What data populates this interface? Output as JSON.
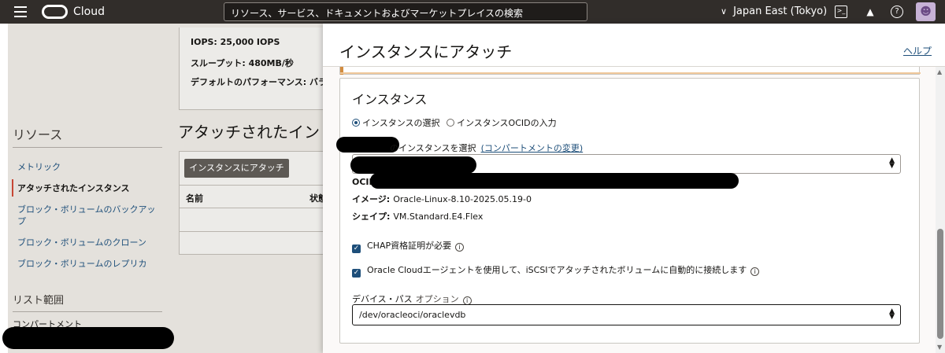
{
  "topbar": {
    "brand": "Cloud",
    "search_placeholder": "リソース、サービス、ドキュメントおよびマーケットプレイスの検索",
    "region": "Japan East (Tokyo)"
  },
  "background": {
    "info": {
      "iops": "IOPS: 25,000 IOPS",
      "throughput": "スループット: 480MB/秒",
      "default_perf": "デフォルトのパフォーマンス: バラ"
    },
    "resources": {
      "title": "リソース",
      "items": [
        "メトリック",
        "アタッチされたインスタンス",
        "ブロック・ボリュームのバックアップ",
        "ブロック・ボリュームのクローン",
        "ブロック・ボリュームのレプリカ"
      ]
    },
    "list_scope": "リスト範囲",
    "compartment_label": "コンパートメント",
    "attached_title": "アタッチされたイン",
    "attach_button": "インスタンスにアタッチ",
    "table_headers": [
      "名前",
      "状態"
    ]
  },
  "panel": {
    "title": "インスタンスにアタッチ",
    "help": "ヘルプ",
    "card_title": "インスタンス",
    "radio_select": "インスタンスの選択",
    "radio_ocid": "インスタンスOCIDの入力",
    "select_label": "のインスタンスを選択",
    "change_compartment": "(コンパートメントの変更)",
    "ocid_label": "OCID",
    "image_label": "イメージ:",
    "image_value": "Oracle-Linux-8.10-2025.05.19-0",
    "shape_label": "シェイプ:",
    "shape_value": "VM.Standard.E4.Flex",
    "chap_label": "CHAP資格証明が必要",
    "agent_label": "Oracle Cloudエージェントを使用して、iSCSIでアタッチされたボリュームに自動的に接続します",
    "device_label": "デバイス・パス",
    "device_optional": "オプション",
    "device_value": "/dev/oracleoci/oraclevdb"
  },
  "colors": {
    "topbar": "#312d2a",
    "link": "#1e4f7a",
    "checkbox": "#1e4f7a"
  }
}
